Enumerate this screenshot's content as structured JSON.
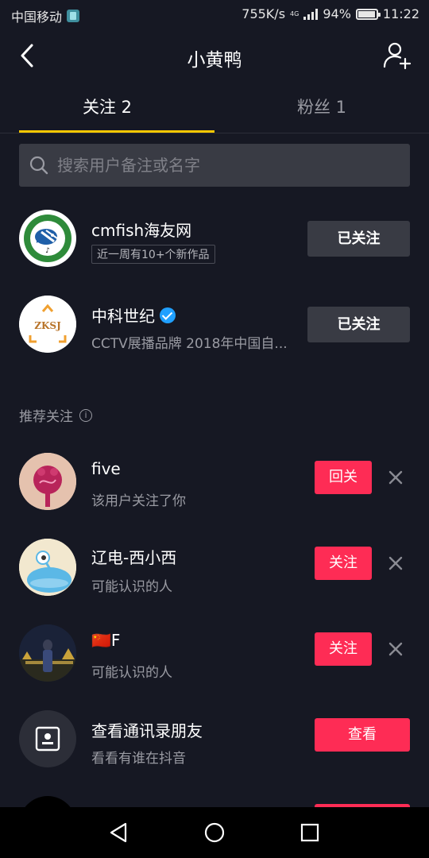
{
  "status_bar": {
    "carrier": "中国移动",
    "speed": "755K/s",
    "network": "4G",
    "battery": "94%",
    "time": "11:22"
  },
  "header": {
    "title": "小黄鸭"
  },
  "tabs": [
    {
      "label": "关注 2",
      "active": true
    },
    {
      "label": "粉丝 1",
      "active": false
    }
  ],
  "search": {
    "placeholder": "搜索用户备注或名字"
  },
  "following": [
    {
      "name": "cmfish海友网",
      "tag": "近一周有10+个新作品",
      "button": "已关注"
    },
    {
      "name": "中科世纪",
      "verified": true,
      "desc": "CCTV展播品牌 2018年中国自...",
      "button": "已关注",
      "logo_text": "ZKSJ"
    }
  ],
  "recommend": {
    "title": "推荐关注",
    "info_icon": "i",
    "items": [
      {
        "name": "five",
        "desc": "该用户关注了你",
        "button": "回关"
      },
      {
        "name": "辽电-西小西",
        "desc": "可能认识的人",
        "button": "关注"
      },
      {
        "name": "🇨🇳F",
        "desc": "可能认识的人",
        "button": "关注"
      }
    ]
  },
  "contacts": {
    "title": "查看通讯录朋友",
    "desc": "看看有谁在抖音",
    "button": "查看"
  },
  "colors": {
    "background": "#161823",
    "accent_red": "#fe2c55",
    "tab_underline": "#fac800",
    "button_gray": "#393b44"
  }
}
